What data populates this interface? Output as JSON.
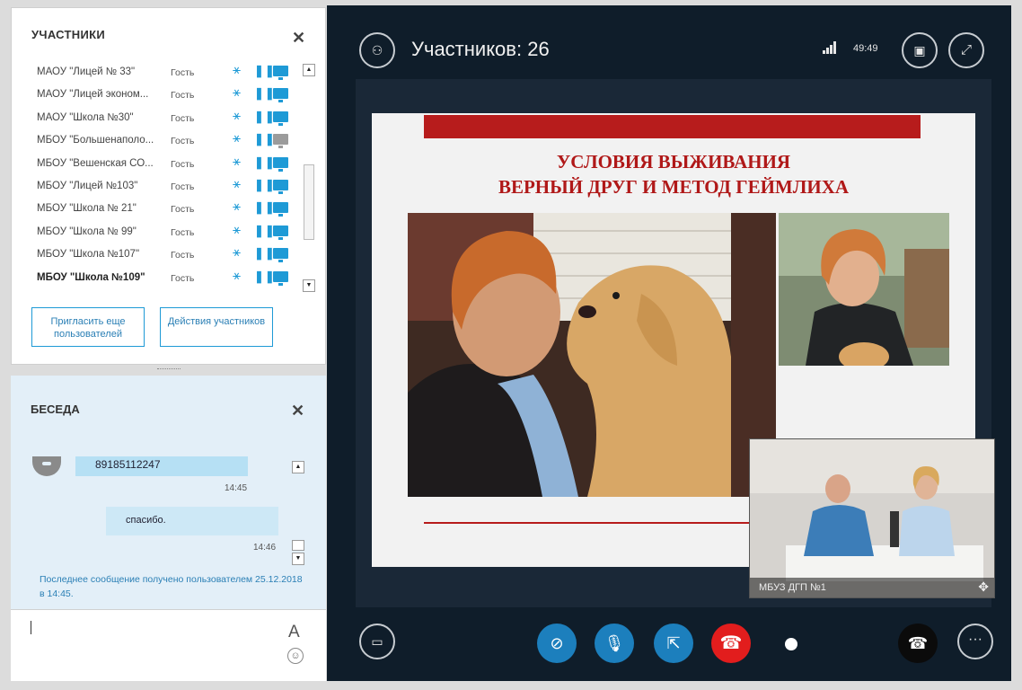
{
  "participants": {
    "title": "УЧАСТНИКИ",
    "rows": [
      {
        "name": "МАОУ \"Лицей № 33\"",
        "role": "Гость",
        "screen": "blue"
      },
      {
        "name": "МАОУ \"Лицей эконом...",
        "role": "Гость",
        "screen": "blue"
      },
      {
        "name": "МАОУ \"Школа №30\"",
        "role": "Гость",
        "screen": "blue"
      },
      {
        "name": "МБОУ \"Большенаполо...",
        "role": "Гость",
        "screen": "gray"
      },
      {
        "name": "МБОУ \"Вешенская СО...",
        "role": "Гость",
        "screen": "blue"
      },
      {
        "name": "МБОУ \"Лицей №103\"",
        "role": "Гость",
        "screen": "blue"
      },
      {
        "name": "МБОУ \"Школа № 21\"",
        "role": "Гость",
        "screen": "blue"
      },
      {
        "name": "МБОУ \"Школа № 99\"",
        "role": "Гость",
        "screen": "blue"
      },
      {
        "name": "МБОУ \"Школа №107\"",
        "role": "Гость",
        "screen": "blue"
      },
      {
        "name": "МБОУ \"Школа №109\"",
        "role": "Гость",
        "screen": "blue",
        "bold": true
      }
    ],
    "invite_button": "Пригласить еще пользователей",
    "actions_button": "Действия участников"
  },
  "chat": {
    "title": "БЕСЕДА",
    "messages": [
      {
        "text": "89185112247",
        "time": "14:45"
      },
      {
        "text": "спасибо.",
        "time": "14:46"
      }
    ],
    "notice": "Последнее сообщение получено пользователем 25.12.2018 в 14:45.",
    "font_icon": "A"
  },
  "meeting": {
    "participants_count": "Участников: 26",
    "time": "49:49",
    "slide": {
      "title_line1": "УСЛОВИЯ ВЫЖИВАНИЯ",
      "title_line2": "ВЕРНЫЙ ДРУГ И МЕТОД ГЕЙМЛИХА"
    },
    "pip_label": "МБУЗ ДГП №1"
  },
  "colors": {
    "accent": "#1e9ad6",
    "stage": "#0f1d2a",
    "end_call": "#e21d1d",
    "slide_red": "#b71c1c"
  }
}
